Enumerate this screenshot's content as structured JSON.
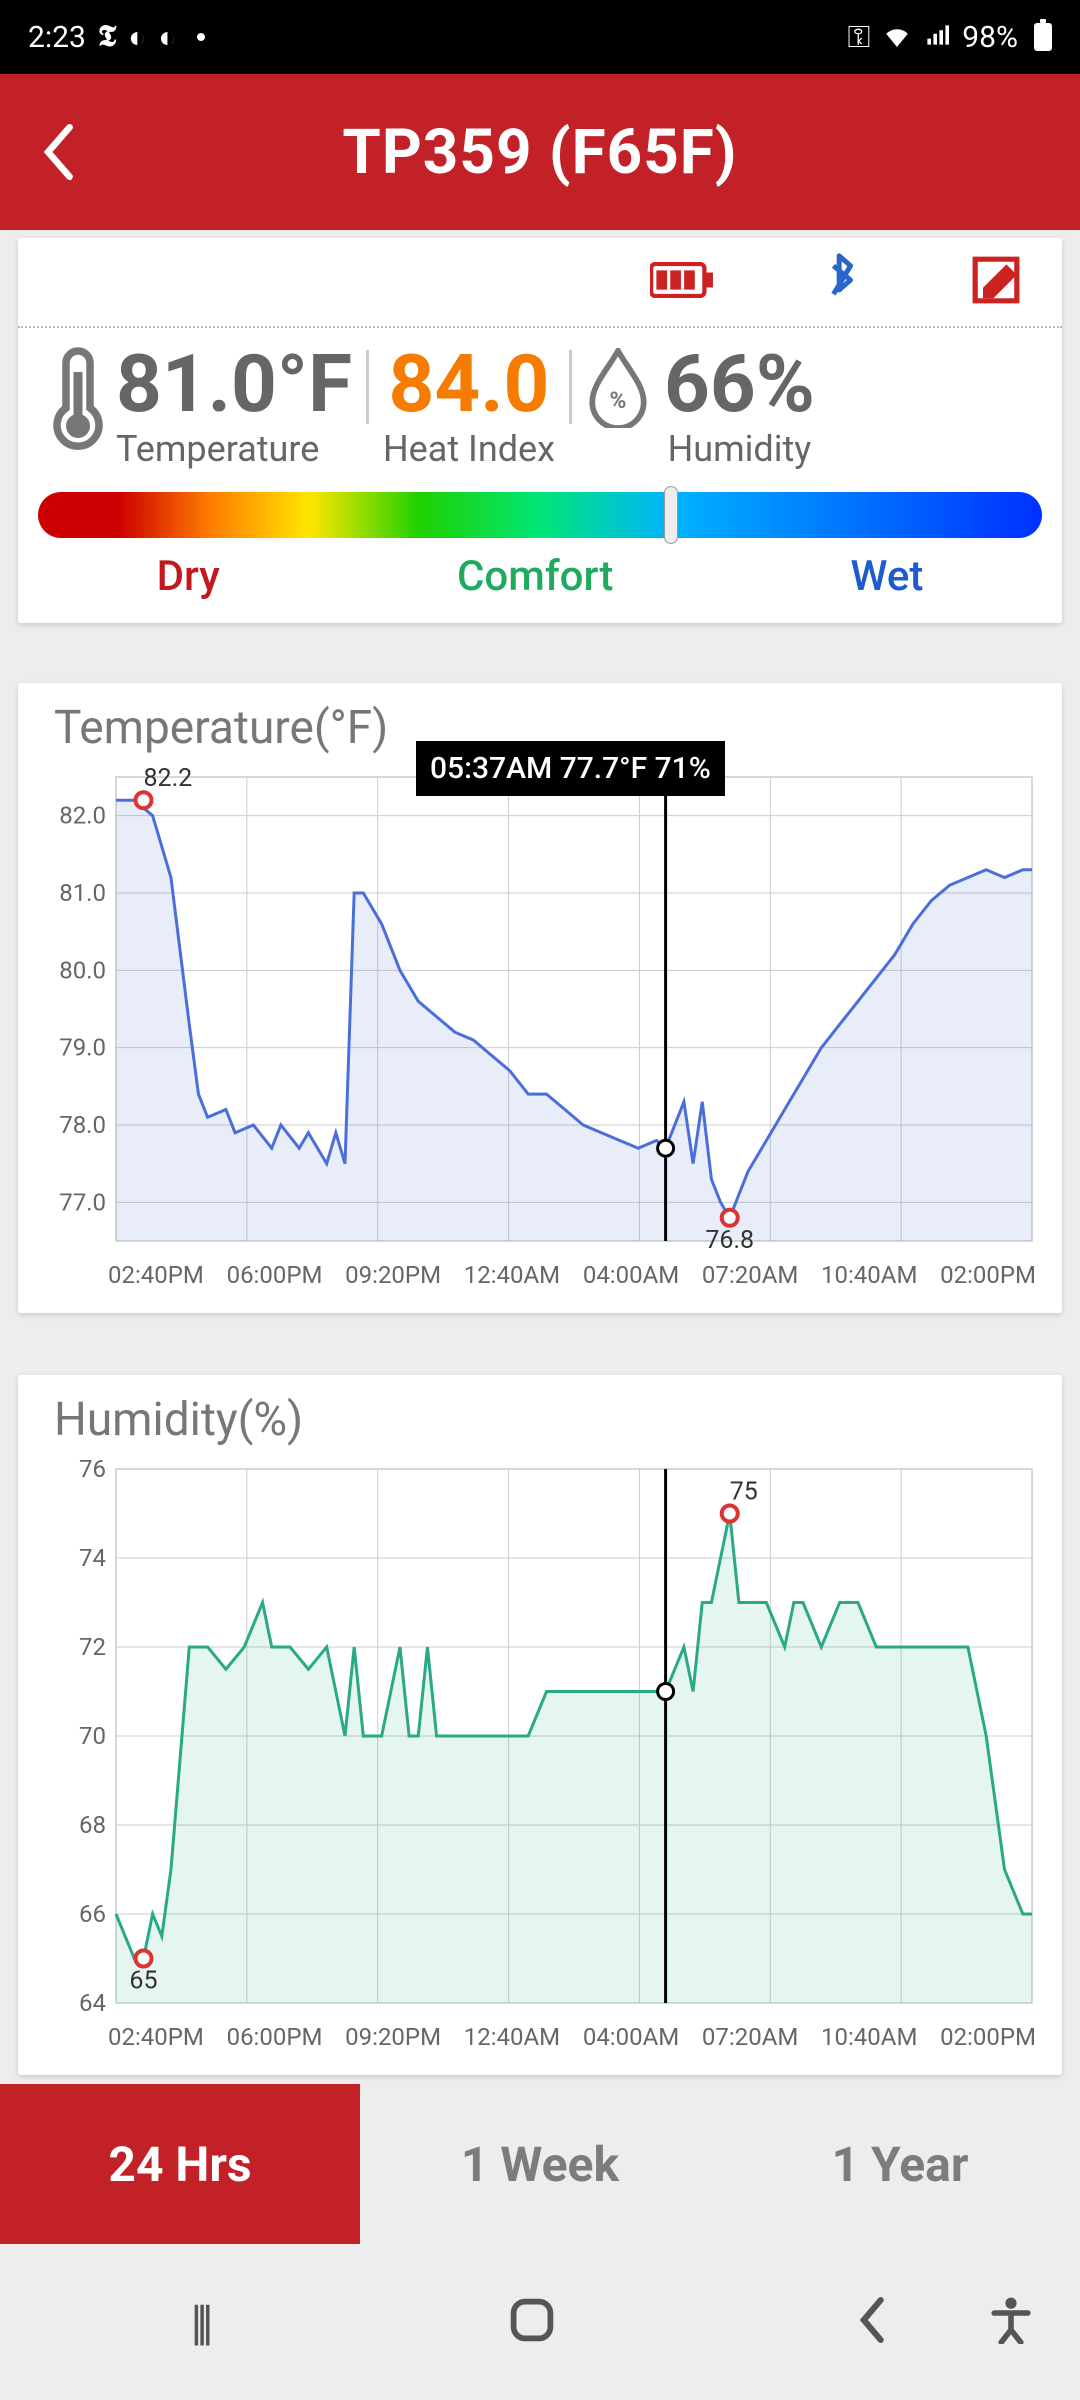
{
  "status": {
    "time": "2:23",
    "battery_pct": "98%"
  },
  "header": {
    "title": "TP359 (F65F)"
  },
  "readings": {
    "temperature_value": "81.0°F",
    "temperature_label": "Temperature",
    "heat_index_value": "84.0",
    "heat_index_label": "Heat Index",
    "humidity_value": "66%",
    "humidity_label": "Humidity",
    "spectrum": {
      "dry": "Dry",
      "comfort": "Comfort",
      "wet": "Wet",
      "marker_pct": 63
    }
  },
  "tooltip": {
    "text": "05:37AM  77.7°F 71%",
    "x_pct": 60
  },
  "time_tabs": {
    "t24": "24 Hrs",
    "week": "1 Week",
    "year": "1 Year",
    "active": "t24"
  },
  "x_axis": [
    "02:40PM",
    "06:00PM",
    "09:20PM",
    "12:40AM",
    "04:00AM",
    "07:20AM",
    "10:40AM",
    "02:00PM"
  ],
  "chart_data": [
    {
      "type": "line",
      "title": "Temperature(°F)",
      "ylabel": "°F",
      "ylim": [
        76.5,
        82.5
      ],
      "yticks": [
        77.0,
        78.0,
        79.0,
        80.0,
        81.0,
        82.0
      ],
      "max_point": {
        "label": "82.2",
        "x_pct": 3,
        "value": 82.2
      },
      "min_point": {
        "label": "76.8",
        "x_pct": 67,
        "value": 76.8
      },
      "cursor_point": {
        "x_pct": 60,
        "value": 77.7
      },
      "series": [
        {
          "name": "temp",
          "color": "#4a6fd8",
          "fill": "rgba(74,111,216,.12)",
          "points": [
            [
              0,
              82.2
            ],
            [
              2,
              82.2
            ],
            [
              4,
              82.0
            ],
            [
              6,
              81.2
            ],
            [
              8,
              79.3
            ],
            [
              9,
              78.4
            ],
            [
              10,
              78.1
            ],
            [
              12,
              78.2
            ],
            [
              13,
              77.9
            ],
            [
              15,
              78.0
            ],
            [
              17,
              77.7
            ],
            [
              18,
              78.0
            ],
            [
              20,
              77.7
            ],
            [
              21,
              77.9
            ],
            [
              23,
              77.5
            ],
            [
              24,
              77.9
            ],
            [
              25,
              77.5
            ],
            [
              26,
              81.0
            ],
            [
              27,
              81.0
            ],
            [
              29,
              80.6
            ],
            [
              31,
              80.0
            ],
            [
              33,
              79.6
            ],
            [
              35,
              79.4
            ],
            [
              37,
              79.2
            ],
            [
              39,
              79.1
            ],
            [
              41,
              78.9
            ],
            [
              43,
              78.7
            ],
            [
              45,
              78.4
            ],
            [
              47,
              78.4
            ],
            [
              49,
              78.2
            ],
            [
              51,
              78.0
            ],
            [
              53,
              77.9
            ],
            [
              55,
              77.8
            ],
            [
              57,
              77.7
            ],
            [
              59,
              77.8
            ],
            [
              60,
              77.7
            ],
            [
              62,
              78.3
            ],
            [
              63,
              77.5
            ],
            [
              64,
              78.3
            ],
            [
              65,
              77.3
            ],
            [
              66,
              77.0
            ],
            [
              67,
              76.8
            ],
            [
              68,
              77.1
            ],
            [
              69,
              77.4
            ],
            [
              71,
              77.8
            ],
            [
              73,
              78.2
            ],
            [
              75,
              78.6
            ],
            [
              77,
              79.0
            ],
            [
              79,
              79.3
            ],
            [
              81,
              79.6
            ],
            [
              83,
              79.9
            ],
            [
              85,
              80.2
            ],
            [
              87,
              80.6
            ],
            [
              89,
              80.9
            ],
            [
              91,
              81.1
            ],
            [
              93,
              81.2
            ],
            [
              95,
              81.3
            ],
            [
              97,
              81.2
            ],
            [
              99,
              81.3
            ],
            [
              100,
              81.3
            ]
          ]
        }
      ]
    },
    {
      "type": "line",
      "title": "Humidity(%)",
      "ylabel": "%",
      "ylim": [
        64,
        76
      ],
      "yticks": [
        64,
        66,
        68,
        70,
        72,
        74,
        76
      ],
      "max_point": {
        "label": "75",
        "x_pct": 67,
        "value": 75
      },
      "min_point": {
        "label": "65",
        "x_pct": 3,
        "value": 65
      },
      "cursor_point": {
        "x_pct": 60,
        "value": 71
      },
      "series": [
        {
          "name": "humidity",
          "color": "#29a985",
          "fill": "rgba(41,169,133,.12)",
          "points": [
            [
              0,
              66
            ],
            [
              2,
              65
            ],
            [
              3,
              65
            ],
            [
              4,
              66
            ],
            [
              5,
              65.5
            ],
            [
              6,
              67
            ],
            [
              8,
              72
            ],
            [
              10,
              72
            ],
            [
              12,
              71.5
            ],
            [
              14,
              72
            ],
            [
              16,
              73
            ],
            [
              17,
              72
            ],
            [
              19,
              72
            ],
            [
              21,
              71.5
            ],
            [
              23,
              72
            ],
            [
              25,
              70
            ],
            [
              26,
              72
            ],
            [
              27,
              70
            ],
            [
              29,
              70
            ],
            [
              31,
              72
            ],
            [
              32,
              70
            ],
            [
              33,
              70
            ],
            [
              34,
              72
            ],
            [
              35,
              70
            ],
            [
              37,
              70
            ],
            [
              39,
              70
            ],
            [
              41,
              70
            ],
            [
              43,
              70
            ],
            [
              45,
              70
            ],
            [
              47,
              71
            ],
            [
              49,
              71
            ],
            [
              51,
              71
            ],
            [
              53,
              71
            ],
            [
              55,
              71
            ],
            [
              57,
              71
            ],
            [
              59,
              71
            ],
            [
              60,
              71
            ],
            [
              62,
              72
            ],
            [
              63,
              71
            ],
            [
              64,
              73
            ],
            [
              65,
              73
            ],
            [
              66,
              74
            ],
            [
              67,
              75
            ],
            [
              68,
              73
            ],
            [
              69,
              73
            ],
            [
              71,
              73
            ],
            [
              73,
              72
            ],
            [
              74,
              73
            ],
            [
              75,
              73
            ],
            [
              77,
              72
            ],
            [
              79,
              73
            ],
            [
              81,
              73
            ],
            [
              83,
              72
            ],
            [
              85,
              72
            ],
            [
              87,
              72
            ],
            [
              89,
              72
            ],
            [
              91,
              72
            ],
            [
              93,
              72
            ],
            [
              95,
              70
            ],
            [
              97,
              67
            ],
            [
              99,
              66
            ],
            [
              100,
              66
            ]
          ]
        }
      ]
    }
  ]
}
